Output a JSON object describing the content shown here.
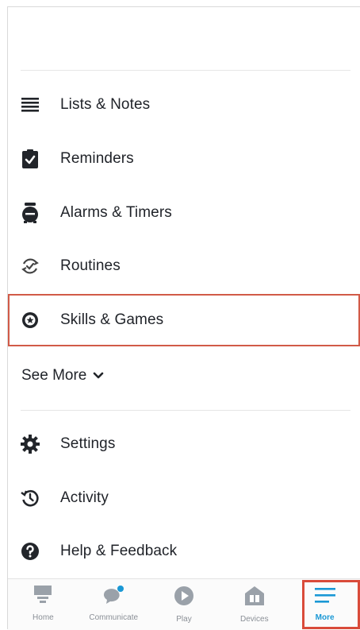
{
  "menu": {
    "items": [
      {
        "label": "Lists & Notes",
        "icon": "list-icon"
      },
      {
        "label": "Reminders",
        "icon": "clipboard-check-icon"
      },
      {
        "label": "Alarms & Timers",
        "icon": "alarm-clock-icon"
      },
      {
        "label": "Routines",
        "icon": "routines-check-icon"
      },
      {
        "label": "Skills & Games",
        "icon": "skills-icon"
      }
    ],
    "see_more": "See More",
    "settings_items": [
      {
        "label": "Settings",
        "icon": "gear-icon"
      },
      {
        "label": "Activity",
        "icon": "history-icon"
      },
      {
        "label": "Help & Feedback",
        "icon": "help-icon"
      }
    ]
  },
  "navbar": {
    "items": [
      {
        "label": "Home",
        "icon": "home-icon"
      },
      {
        "label": "Communicate",
        "icon": "chat-icon"
      },
      {
        "label": "Play",
        "icon": "play-icon"
      },
      {
        "label": "Devices",
        "icon": "devices-icon"
      },
      {
        "label": "More",
        "icon": "menu-icon",
        "active": true
      }
    ]
  },
  "colors": {
    "accent": "#1a98d5",
    "highlight": "#d15a47",
    "text": "#1f2228",
    "nav_inactive": "#8a8f96"
  }
}
